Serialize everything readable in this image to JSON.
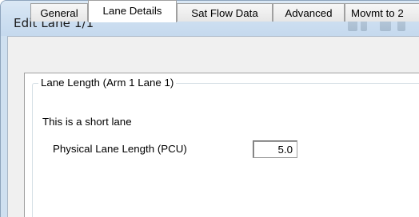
{
  "window": {
    "title": "Edit Lane 1/1"
  },
  "tabs": [
    {
      "label": "General",
      "active": false
    },
    {
      "label": "Lane Details",
      "active": true
    },
    {
      "label": "Sat Flow Data",
      "active": false
    },
    {
      "label": "Advanced",
      "active": false
    },
    {
      "label": "Movmt to 2",
      "active": false
    }
  ],
  "lane_details": {
    "group_title": "Lane Length (Arm 1 Lane 1)",
    "note": "This is a short lane",
    "length_label": "Physical Lane Length (PCU)",
    "length_value": "5.0"
  },
  "colors": {
    "frame": "#cfe0f0",
    "client_bg": "#f0f0f0",
    "panel_bg": "#ffffff",
    "tab_border": "#a0a0a0"
  }
}
